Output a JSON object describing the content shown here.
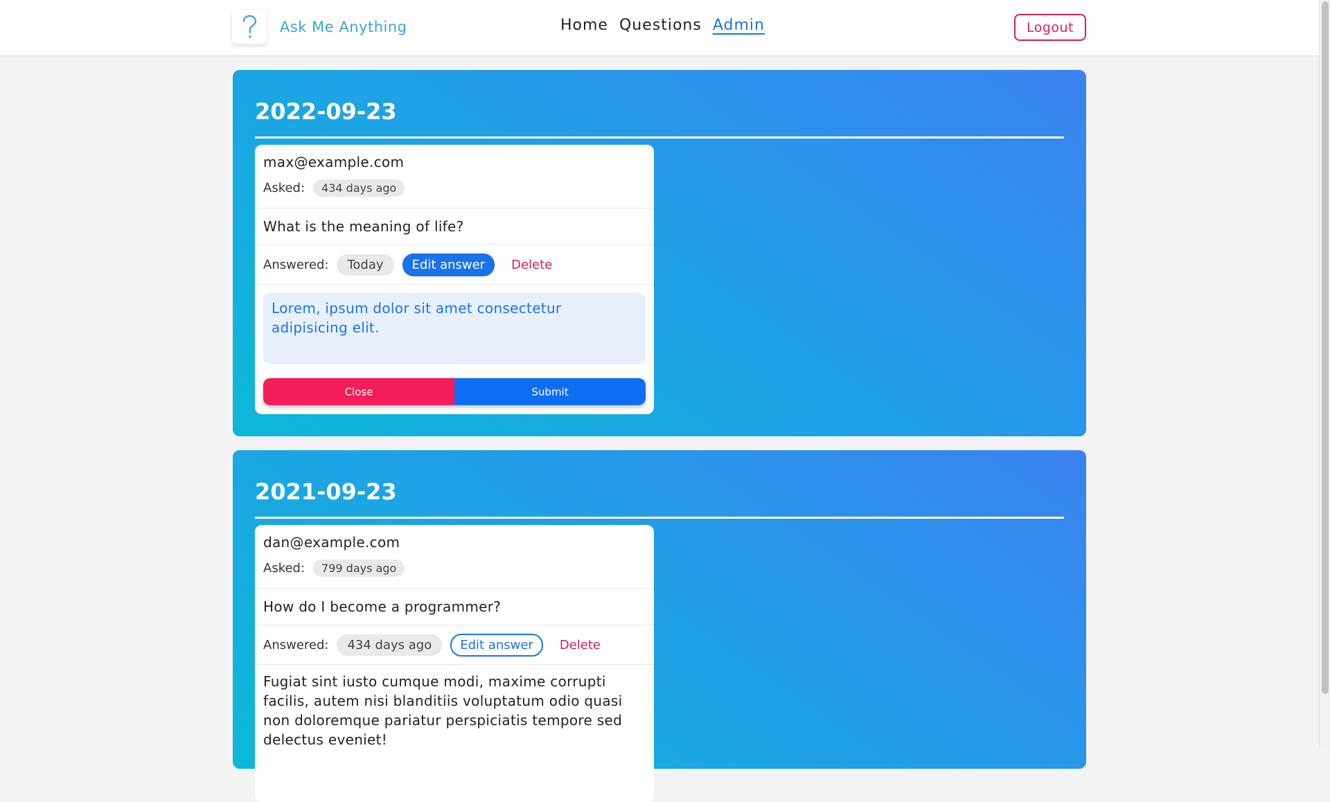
{
  "header": {
    "brand": "Ask Me Anything",
    "logo_icon": "question-mark-icon",
    "nav": [
      {
        "label": "Home"
      },
      {
        "label": "Questions"
      },
      {
        "label": "Admin",
        "active": true
      }
    ],
    "logout_label": "Logout"
  },
  "groups": [
    {
      "date": "2022-09-23",
      "card": {
        "email": "max@example.com",
        "asked_label": "Asked:",
        "asked_ago": "434 days ago",
        "question": "What is the meaning of life?",
        "answered_label": "Answered:",
        "answered_ago": "Today",
        "edit_label": "Edit answer",
        "delete_label": "Delete",
        "answer_draft": "Lorem, ipsum dolor sit amet consectetur adipisicing elit.",
        "close_label": "Close",
        "submit_label": "Submit"
      }
    },
    {
      "date": "2021-09-23",
      "card": {
        "email": "dan@example.com",
        "asked_label": "Asked:",
        "asked_ago": "799 days ago",
        "question": "How do I become a programmer?",
        "answered_label": "Answered:",
        "answered_ago": "434 days ago",
        "edit_label": "Edit answer",
        "delete_label": "Delete",
        "answer": "Fugiat sint iusto cumque modi, maxime corrupti facilis, autem nisi blanditiis voluptatum odio quasi non doloremque pariatur perspiciatis tempore sed delectus eveniet!"
      }
    }
  ],
  "colors": {
    "accent": "#1a73e8",
    "danger": "#d81b60",
    "brand": "#3aa4d8",
    "gradient_start": "#3b82f0",
    "gradient_end": "#0cb8d8"
  }
}
